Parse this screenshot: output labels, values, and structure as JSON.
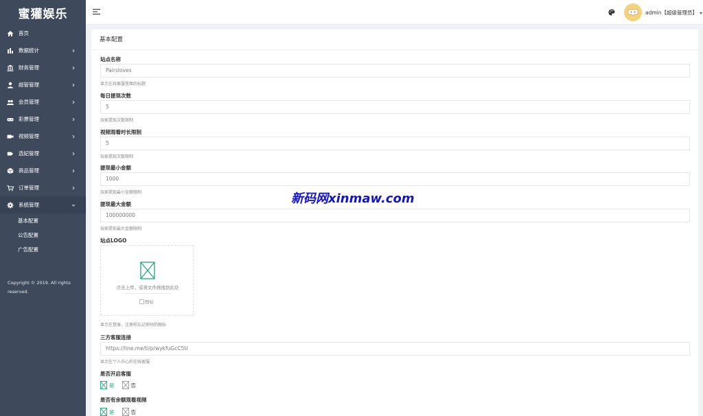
{
  "sidebar": {
    "brand": "蜜獾娱乐",
    "menu": [
      {
        "label": "首页",
        "icon": "home-icon"
      },
      {
        "label": "数据统计",
        "icon": "bar-chart-icon"
      },
      {
        "label": "财务管理",
        "icon": "bank-icon"
      },
      {
        "label": "超管管理",
        "icon": "user-icon"
      },
      {
        "label": "会员管理",
        "icon": "users-icon"
      },
      {
        "label": "彩票管理",
        "icon": "ticket-icon"
      },
      {
        "label": "视频管理",
        "icon": "video-icon"
      },
      {
        "label": "选妃管理",
        "icon": "tag-icon"
      },
      {
        "label": "商品管理",
        "icon": "cube-icon"
      },
      {
        "label": "订单管理",
        "icon": "cart-icon"
      },
      {
        "label": "系统管理",
        "icon": "gear-icon"
      }
    ],
    "submenu": [
      "基本配置",
      "公告配置",
      "广告配置"
    ],
    "copyright": "Copyright © 2019. All rights reserved."
  },
  "topbar": {
    "user": "admin【超级管理员】"
  },
  "form": {
    "title": "基本配置",
    "site_name_label": "站点名称",
    "site_name_value": "Pairsloves",
    "site_name_help": "显示在线客服里面的标题",
    "daily_withdraw_label": "每日提现次数",
    "daily_withdraw_value": "5",
    "daily_withdraw_help": "玩家提现次数限制",
    "video_limit_label": "视频观看时长限制",
    "video_limit_value": "5",
    "video_limit_help": "玩家提现次数限制",
    "min_withdraw_label": "提现最小金额",
    "min_withdraw_value": "1000",
    "min_withdraw_help": "玩家提现最小金额限制",
    "max_withdraw_label": "提现最大金额",
    "max_withdraw_value": "100000000",
    "max_withdraw_help": "玩家提现最大金额限制",
    "logo_label": "站点LOGO",
    "logo_upload_text": "点击上传，或将文件拖拽到此处",
    "logo_img_alt": "图标",
    "logo_help": "显示在登录、注册和忘记密码的图标",
    "cs_link_label": "三方客服连接",
    "cs_link_value": "https://line.me/ti/p/wykfuGcC5U",
    "cs_link_help": "显示在个人中心的在线客服",
    "cs_enable_label": "是否开启客服",
    "yes": "是",
    "no": "否",
    "extra_video_label": "是否有余额观看视频"
  },
  "watermark": "新码网xinmaw.com",
  "colors": {
    "sidebar_bg": "#3e4a5c",
    "accent_green": "#1ea774",
    "avatar_bg": "#f4d27e"
  }
}
